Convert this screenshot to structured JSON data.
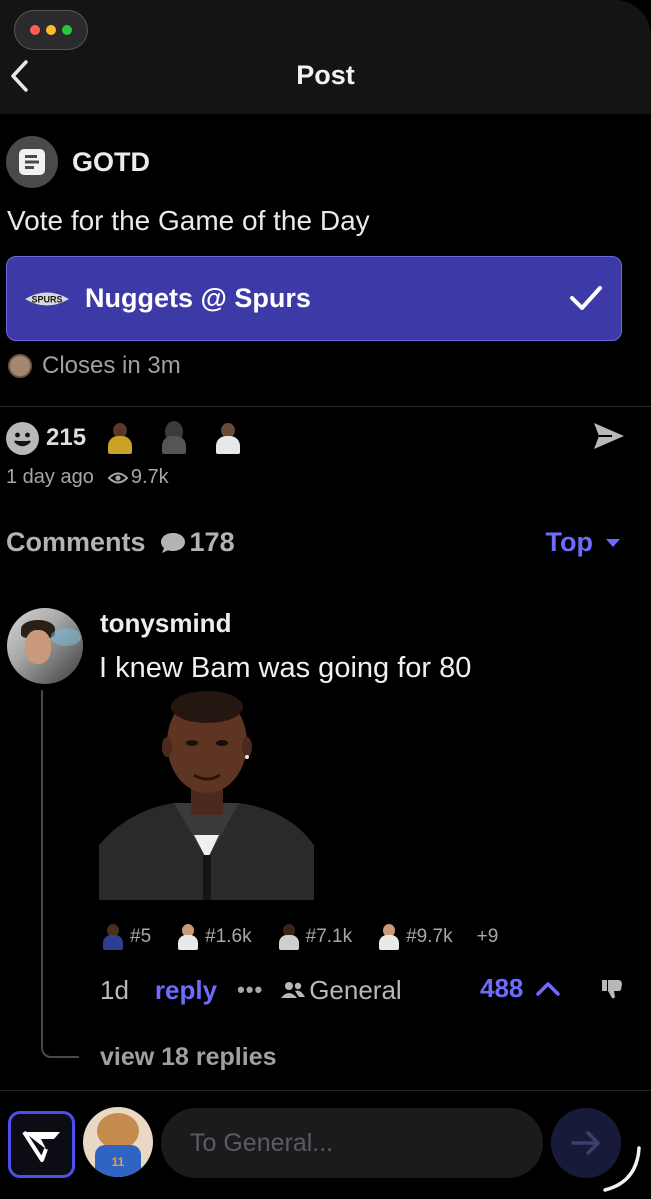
{
  "header": {
    "title": "Post",
    "back_icon": "chevron-left-icon"
  },
  "window_controls": {
    "colors": [
      "#ff5f57",
      "#febc2e",
      "#28c840"
    ]
  },
  "post": {
    "author": "GOTD",
    "author_icon": "document-icon",
    "question": "Vote for the Game of the Day",
    "option": {
      "label": "Nuggets @ Spurs",
      "team_logo": "spurs-logo-icon",
      "selected": true,
      "color": "#3d3aa8"
    },
    "closes": "Closes in 3m",
    "reactions": {
      "count": "215",
      "icon": "smiley-icon"
    },
    "time_ago": "1 day ago",
    "views": "9.7k"
  },
  "comments": {
    "label": "Comments",
    "count": "178",
    "sort": "Top",
    "accent": "#6e6bff",
    "items": [
      {
        "user": "tonysmind",
        "text": "I knew Bam was going for 80",
        "badges": [
          "#5",
          "#1.6k",
          "#7.1k",
          "#9.7k"
        ],
        "extra_badges": "+9",
        "time": "1d",
        "reply_label": "reply",
        "more_label": "•••",
        "channel": "General",
        "votes": "488",
        "view_replies": "view 18 replies"
      }
    ]
  },
  "composer": {
    "placeholder": "To General...",
    "jersey_number": "11"
  }
}
